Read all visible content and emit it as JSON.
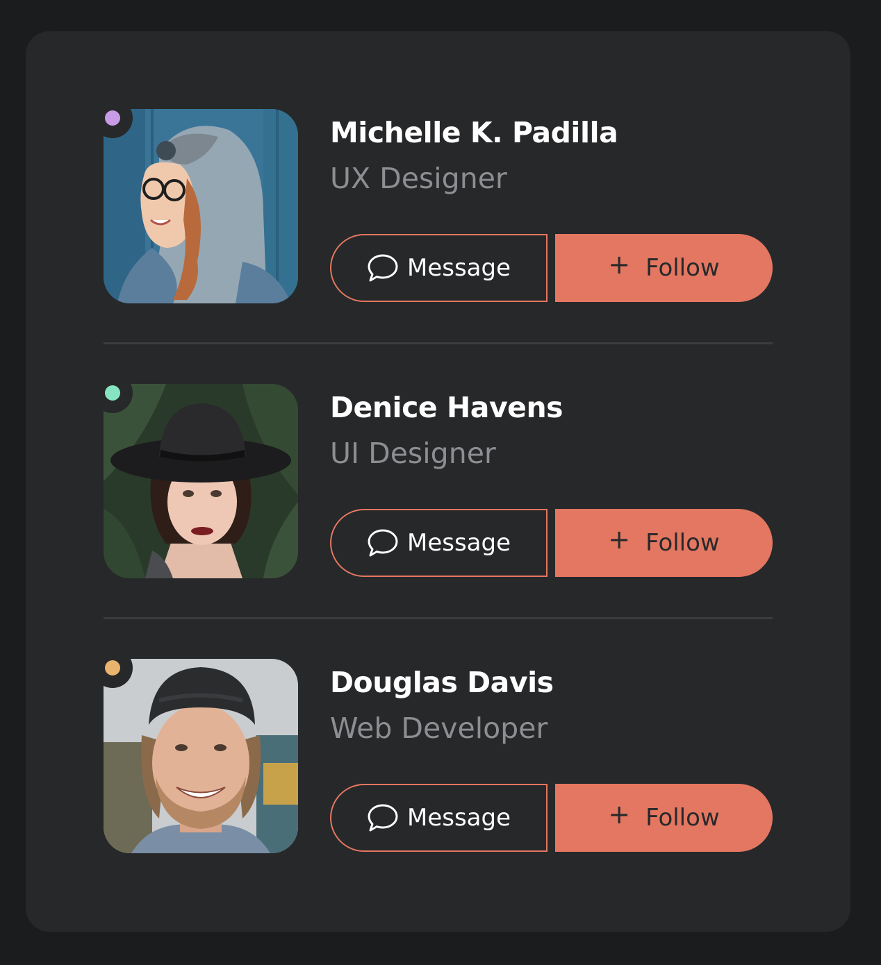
{
  "colors": {
    "page_bg": "#1b1c1e",
    "card_bg": "#27282a",
    "accent": "#e47761",
    "muted_text": "#8d8e91",
    "divider": "#3b3c3f"
  },
  "profiles": [
    {
      "name": "Michelle K. Padilla",
      "role": "UX Designer",
      "status_color": "#c79be6",
      "message_label": "Message",
      "message_icon": "chat-bubble-icon",
      "follow_label": "Follow",
      "follow_icon": "plus-icon"
    },
    {
      "name": "Denice Havens",
      "role": "UI Designer",
      "status_color": "#86e5c0",
      "message_label": "Message",
      "message_icon": "chat-bubble-icon",
      "follow_label": "Follow",
      "follow_icon": "plus-icon"
    },
    {
      "name": "Douglas Davis",
      "role": "Web Developer",
      "status_color": "#e9b46d",
      "message_label": "Message",
      "message_icon": "chat-bubble-icon",
      "follow_label": "Follow",
      "follow_icon": "plus-icon"
    }
  ]
}
